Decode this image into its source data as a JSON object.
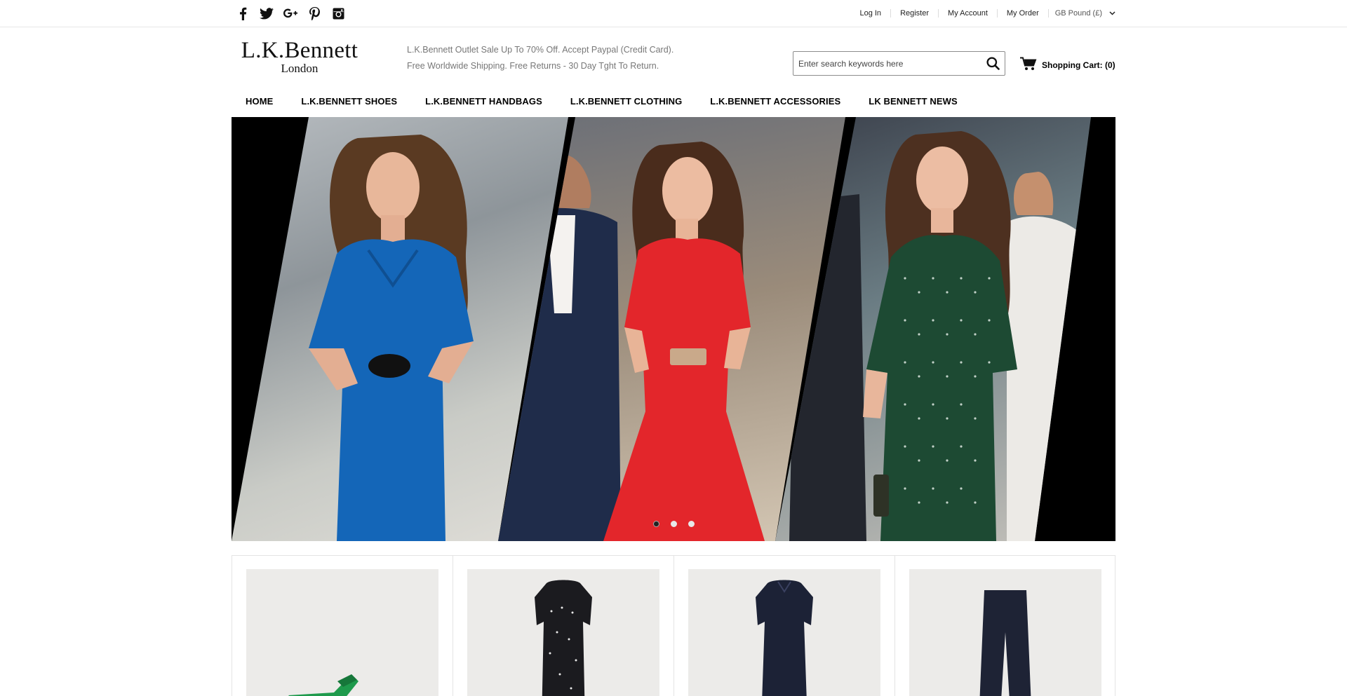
{
  "social": [
    {
      "name": "facebook-icon"
    },
    {
      "name": "twitter-icon"
    },
    {
      "name": "google-plus-icon"
    },
    {
      "name": "pinterest-icon"
    },
    {
      "name": "instagram-icon"
    }
  ],
  "top_links": {
    "login": "Log In",
    "register": "Register",
    "account": "My Account",
    "order": "My Order",
    "currency": "GB Pound (£)"
  },
  "logo": {
    "brand": "L.K.Bennett",
    "city": "London"
  },
  "promo": {
    "line1": "L.K.Bennett Outlet Sale Up To 70% Off. Accept Paypal (Credit Card).",
    "line2": "Free Worldwide Shipping. Free Returns - 30 Day Tght To Return."
  },
  "search": {
    "placeholder": "Enter search keywords here",
    "icon": "search-icon"
  },
  "cart": {
    "label": "Shopping Cart: (0)",
    "icon": "cart-icon"
  },
  "nav": [
    "HOME",
    "L.K.BENNETT SHOES",
    "L.K.BENNETT HANDBAGS",
    "L.K.BENNETT CLOTHING",
    "L.K.BENNETT ACCESSORIES",
    "LK BENNETT NEWS"
  ],
  "hero": {
    "slides": 3,
    "active_slide": 1,
    "dress_colors": [
      "#1466b8",
      "#e3262b",
      "#1d4a33"
    ]
  },
  "products": [
    {
      "kind": "shoe",
      "color": "#1e9a4c"
    },
    {
      "kind": "print-dress",
      "color": "#1b1b1f"
    },
    {
      "kind": "shirt-dress",
      "color": "#1c2236"
    },
    {
      "kind": "trousers",
      "color": "#1e2335"
    }
  ],
  "colors": {
    "text": "#000000",
    "muted": "#777777",
    "border": "#e4e4e4",
    "product_bg": "#ecebe9"
  }
}
